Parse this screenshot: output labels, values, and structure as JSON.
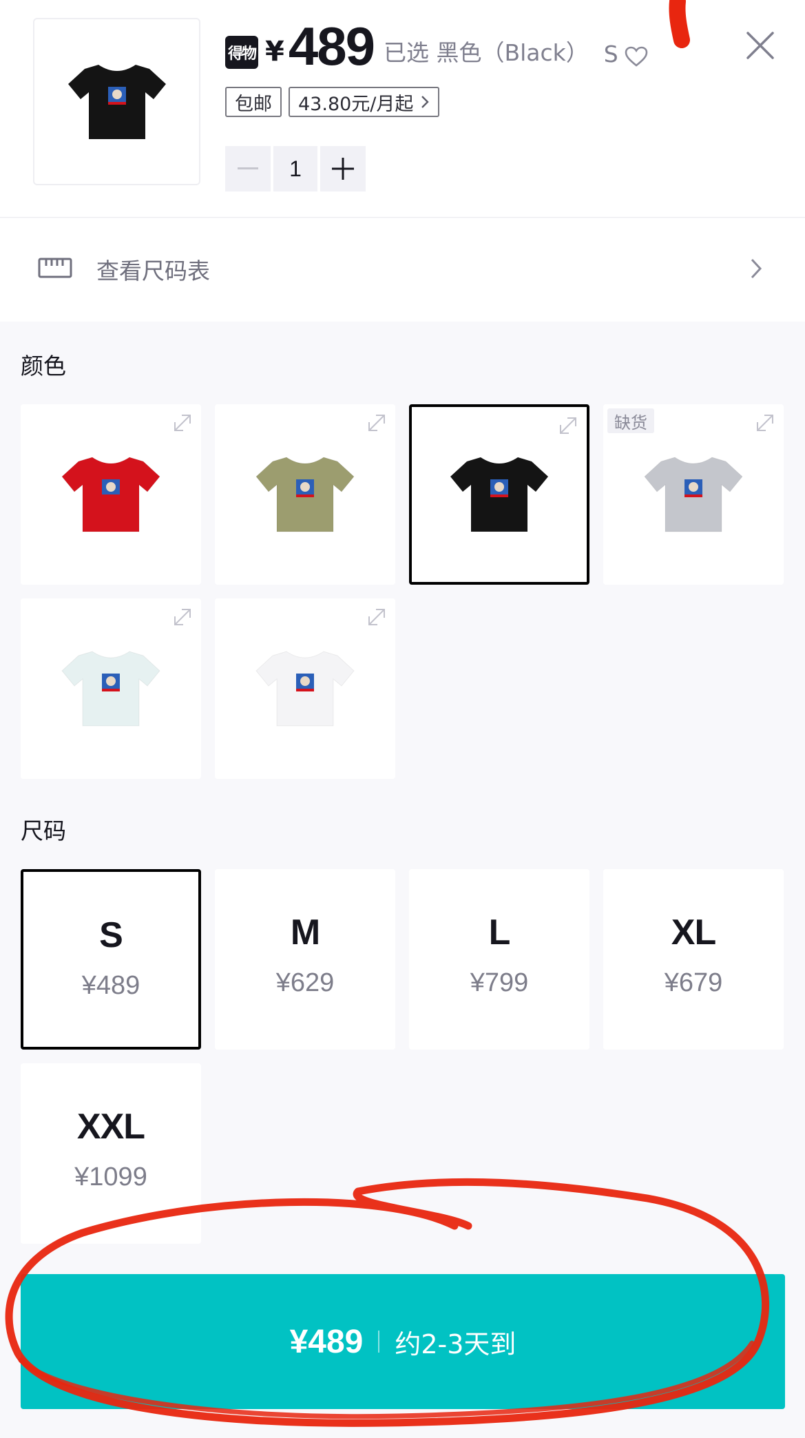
{
  "header": {
    "brand_badge": "得物",
    "currency": "¥",
    "price": "489",
    "selected_prefix": "已选",
    "selected_color": "黑色（Black）",
    "selected_size": "S",
    "tags": {
      "free_shipping": "包邮",
      "installment": "43.80元/月起"
    },
    "quantity": "1"
  },
  "size_chart": {
    "label": "查看尺码表"
  },
  "colors": {
    "title": "颜色",
    "out_of_stock_label": "缺货",
    "items": [
      {
        "shirt": "#d4121c",
        "selected": false,
        "out_of_stock": false
      },
      {
        "shirt": "#9c9d6f",
        "selected": false,
        "out_of_stock": false
      },
      {
        "shirt": "#141414",
        "selected": true,
        "out_of_stock": false
      },
      {
        "shirt": "#c4c6cc",
        "selected": false,
        "out_of_stock": true
      },
      {
        "shirt": "#e6f1f1",
        "selected": false,
        "out_of_stock": false
      },
      {
        "shirt": "#f4f4f6",
        "selected": false,
        "out_of_stock": false
      }
    ]
  },
  "sizes": {
    "title": "尺码",
    "items": [
      {
        "name": "S",
        "price": "¥489",
        "selected": true
      },
      {
        "name": "M",
        "price": "¥629",
        "selected": false
      },
      {
        "name": "L",
        "price": "¥799",
        "selected": false
      },
      {
        "name": "XL",
        "price": "¥679",
        "selected": false
      },
      {
        "name": "XXL",
        "price": "¥1099",
        "selected": false
      }
    ]
  },
  "buy": {
    "price": "¥489",
    "eta": "约2-3天到"
  },
  "theme": {
    "accent": "#01c2c3",
    "annotation": "#e8260f"
  }
}
